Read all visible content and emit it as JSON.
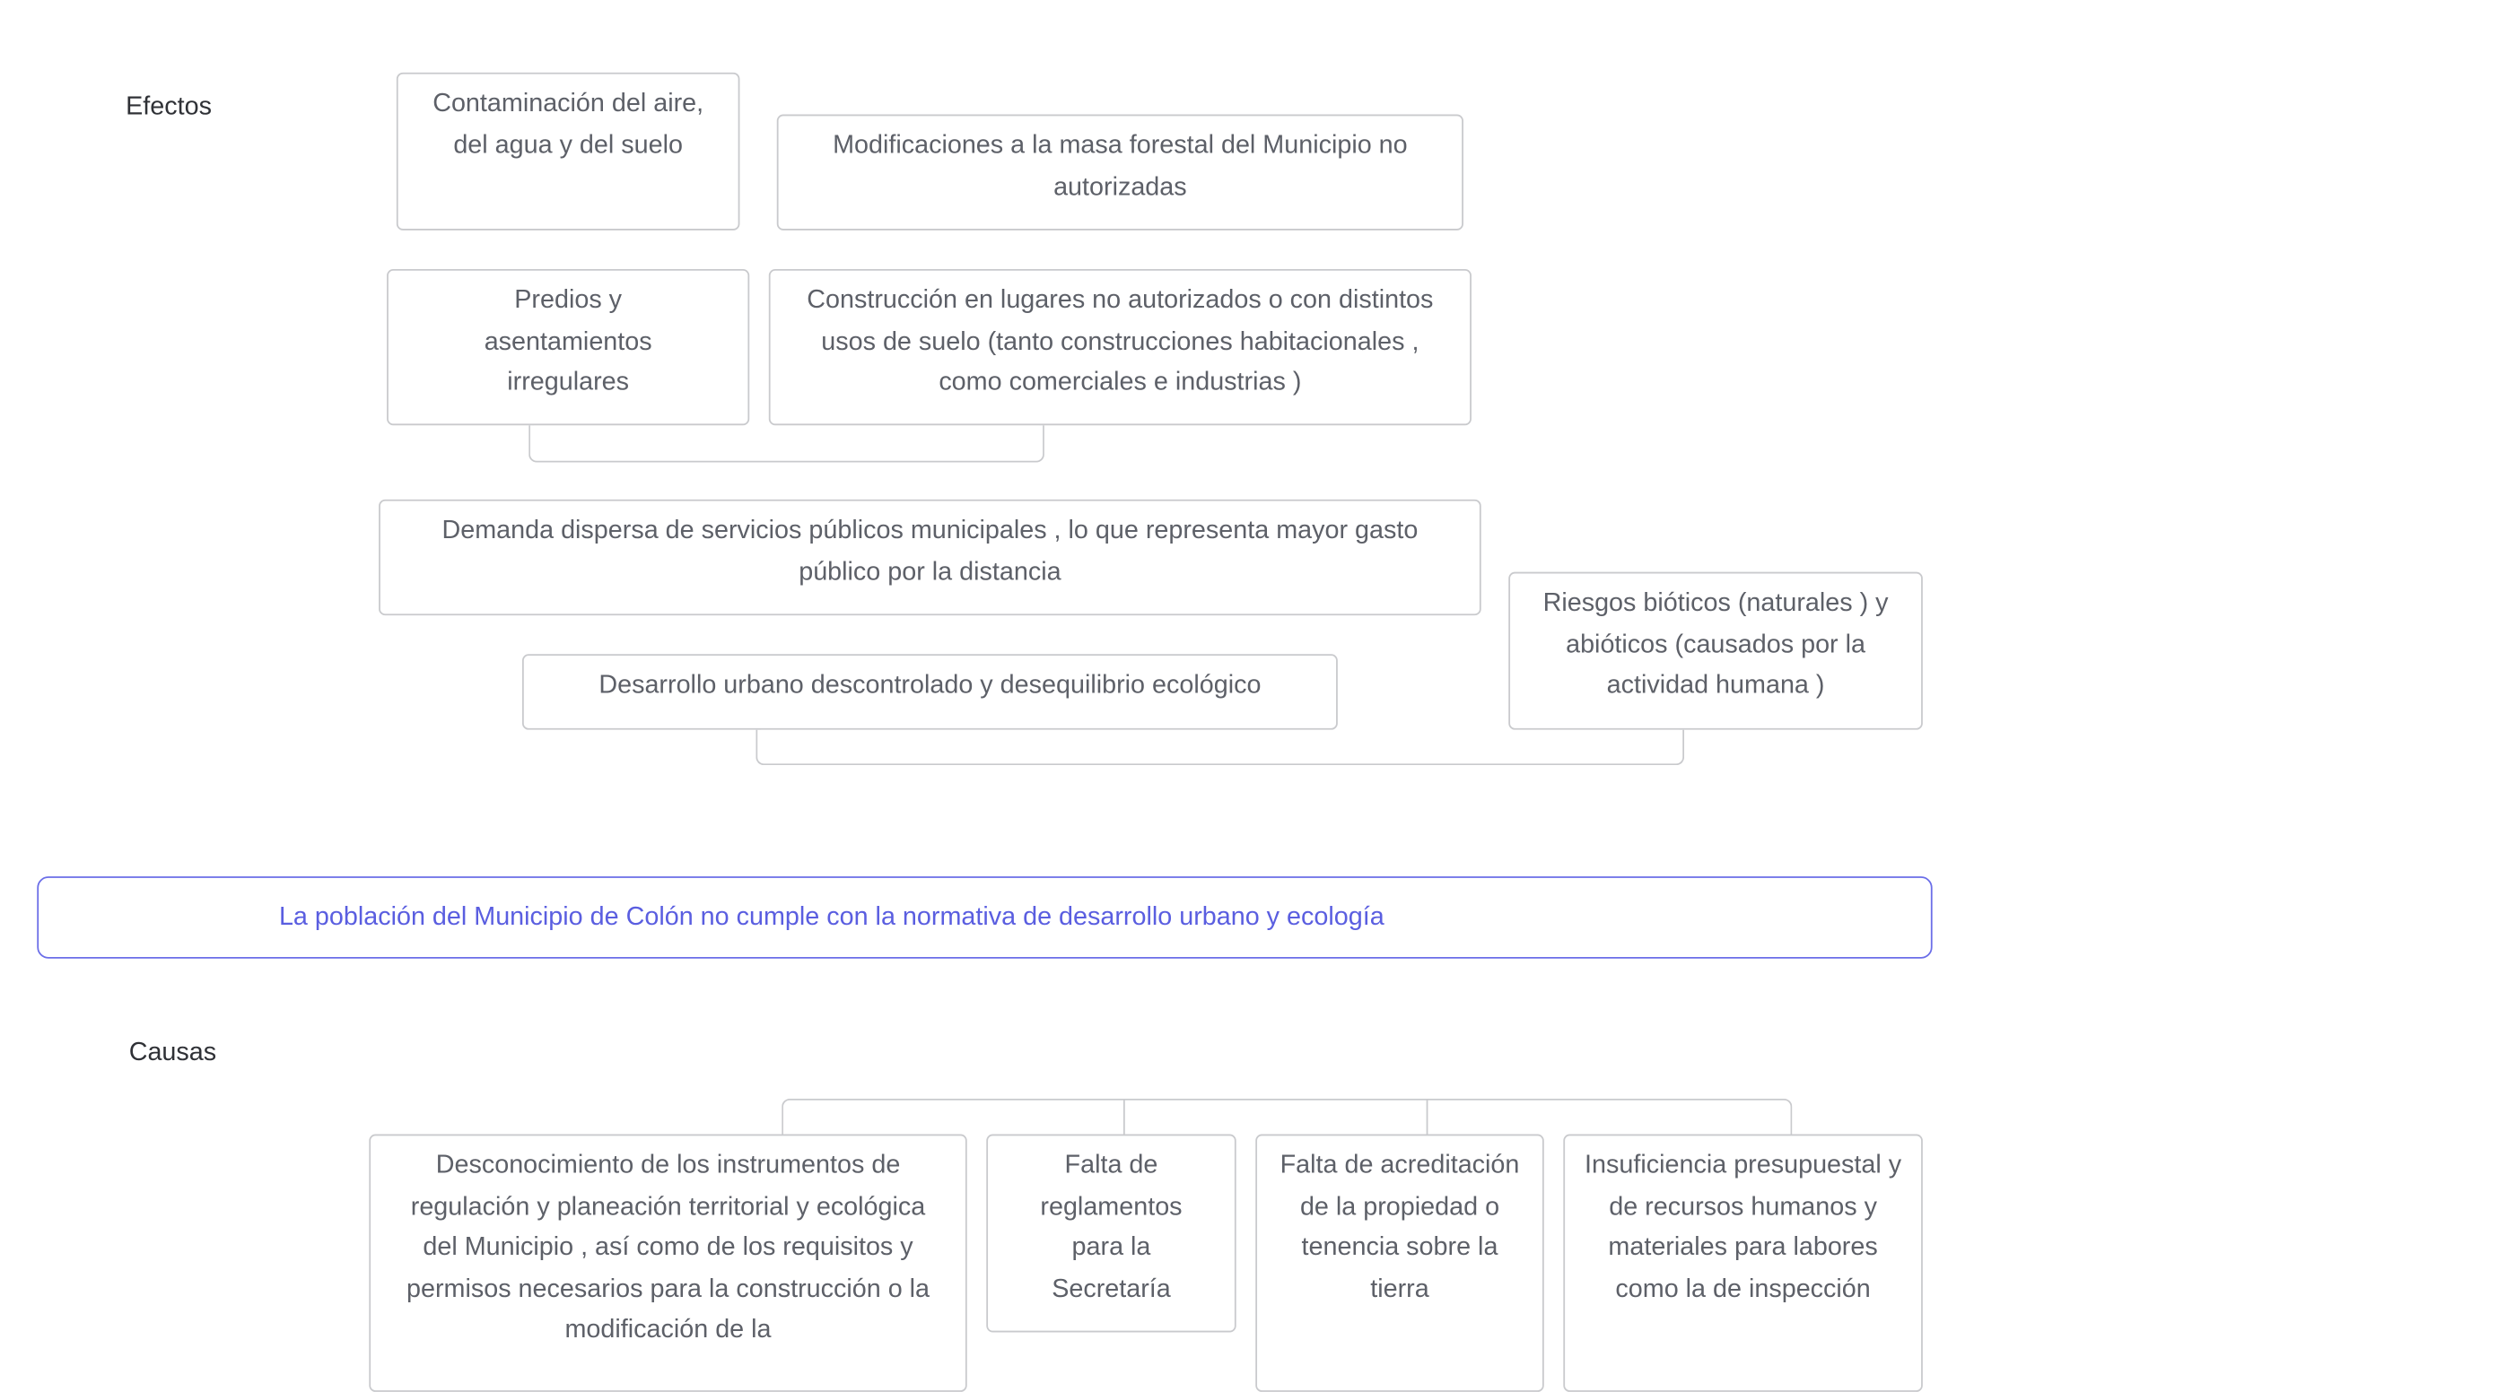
{
  "labels": {
    "effects": "Efectos",
    "causes": "Causas"
  },
  "effects": {
    "e1": "Contaminación del aire, del agua y del suelo",
    "e2": "Modificaciones a la masa forestal del Municipio no autorizadas",
    "e3": "Predios y asentamientos irregulares",
    "e4": "Construcción en lugares no autorizados o con distintos usos de suelo (tanto construcciones habitacionales , como comerciales e industrias )",
    "e5": "Demanda dispersa de servicios públicos municipales , lo que representa mayor gasto público por la distancia",
    "e6": "Desarrollo urbano descontrolado y desequilibrio ecológico",
    "e7": "Riesgos bióticos (naturales ) y abióticos (causados por la actividad humana )"
  },
  "problem": "La población del Municipio de Colón no cumple con la normativa de desarrollo urbano y ecología",
  "causes": {
    "c1": "Desconocimiento de los instrumentos de regulación y planeación territorial y ecológica del Municipio , así como de los requisitos y permisos necesarios para la construcción o la modificación de la",
    "c2": "Falta de reglamentos para la Secretaría",
    "c3": "Falta de acreditación de la propiedad o tenencia sobre la tierra",
    "c4": "Insuficiencia presupuestal y de recursos humanos y materiales para labores como la de inspección"
  },
  "colors": {
    "problem_border": "#6b6ee8",
    "problem_text": "#5a5ee0",
    "box_border": "#c9cacd",
    "box_text": "#5d6068"
  }
}
